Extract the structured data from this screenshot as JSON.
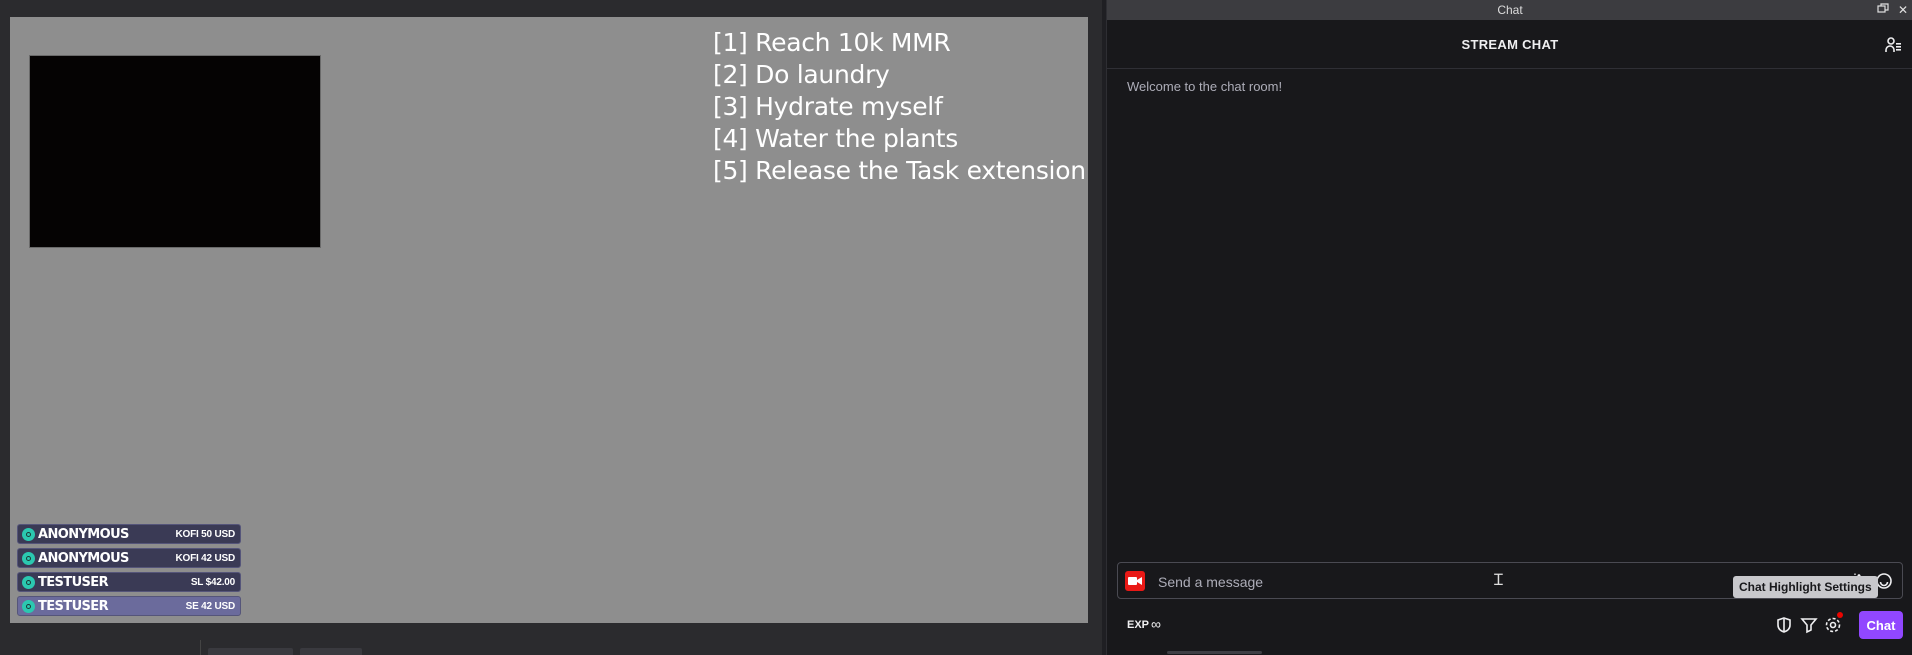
{
  "overlay": {
    "tasks": [
      "[1] Reach 10k MMR",
      "[2] Do laundry",
      "[3] Hydrate myself",
      "[4] Water the plants",
      "[5] Release the Task extension"
    ],
    "donations": [
      {
        "name": "ANONYMOUS",
        "amount": "KOFI 50 USD"
      },
      {
        "name": "ANONYMOUS",
        "amount": "KOFI 42 USD"
      },
      {
        "name": "TESTUSER",
        "amount": "SL $42.00"
      },
      {
        "name": "TESTUSER",
        "amount": "SE 42 USD"
      }
    ]
  },
  "chat": {
    "window_title": "Chat",
    "header_title": "STREAM CHAT",
    "welcome": "Welcome to the chat room!",
    "input_placeholder": "Send a message",
    "tooltip": "Chat Highlight Settings",
    "exp_label": "EXP",
    "exp_value": "∞",
    "send_label": "Chat",
    "accent_color": "#9147ff"
  },
  "icons": {
    "titlebar": [
      "restore-icon",
      "close-icon"
    ],
    "header": "users-icon",
    "input": [
      "camera-icon",
      "sparkle-icon",
      "emote-icon"
    ],
    "footer": [
      "shield-icon",
      "highlight-icon",
      "settings-icon"
    ]
  }
}
